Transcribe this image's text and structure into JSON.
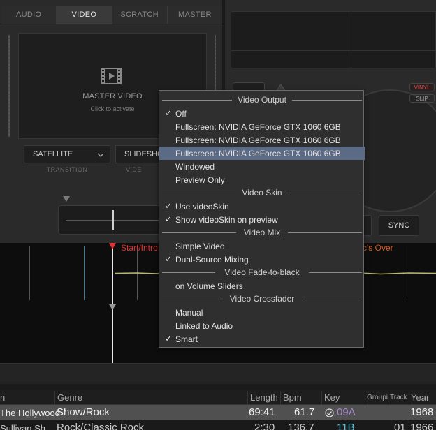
{
  "tabs": [
    {
      "label": "AUDIO"
    },
    {
      "label": "VIDEO"
    },
    {
      "label": "SCRATCH"
    },
    {
      "label": "MASTER"
    }
  ],
  "video_panel": {
    "title": "MASTER VIDEO",
    "subtitle": "Click to activate"
  },
  "transition": {
    "value": "SATELLITE",
    "label": "TRANSITION"
  },
  "video_fx": {
    "value": "SLIDESHO",
    "label": "VIDE"
  },
  "deck": {
    "vinyl": "VINYL",
    "slip": "SLIP",
    "sync": "SYNC"
  },
  "waveform": {
    "cue_left": "Start/Intro",
    "cue_right": "c's Over"
  },
  "menu": {
    "sections": {
      "video_output": "Video Output",
      "video_skin": "Video Skin",
      "video_mix": "Video Mix",
      "fade": "Video Fade-to-black",
      "crossfader": "Video Crossfader"
    },
    "items": {
      "off": "Off",
      "fs1": "Fullscreen: NVIDIA GeForce GTX 1060 6GB",
      "fs2": "Fullscreen: NVIDIA GeForce GTX 1060 6GB",
      "fs3": "Fullscreen: NVIDIA GeForce GTX 1060 6GB",
      "windowed": "Windowed",
      "preview": "Preview Only",
      "use_skin": "Use videoSkin",
      "show_skin": "Show videoSkin on preview",
      "simple": "Simple Video",
      "dual": "Dual-Source Mixing",
      "volume": "on Volume Sliders",
      "manual": "Manual",
      "linked": "Linked to Audio",
      "smart": "Smart"
    }
  },
  "table": {
    "headers": {
      "first": "n",
      "genre": "Genre",
      "length": "Length",
      "bpm": "Bpm",
      "key": "Key",
      "grouping": "Groupi",
      "track": "Track",
      "year": "Year"
    },
    "rows": [
      {
        "artist": "The Hollywood",
        "genre": "Show/Rock",
        "length": "69:41",
        "bpm": "61.7",
        "key": "09A",
        "track": "",
        "year": "1968"
      },
      {
        "artist": "Sullivan Sh",
        "genre": "Rock/Classic Rock",
        "length": "2:30",
        "bpm": "136.7",
        "key": "11B",
        "track": "01",
        "year": "1966"
      }
    ]
  },
  "colors": {
    "accent_selection": "#5b6a85",
    "cue_red": "#e03030",
    "cue_orange": "#e05a1e",
    "key_purple": "#a489c8",
    "key_blue": "#5bc0d8"
  }
}
